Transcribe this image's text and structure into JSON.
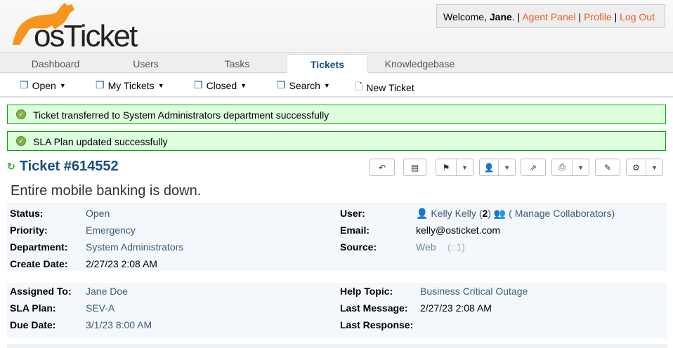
{
  "header": {
    "logo_text": "osTicket",
    "welcome_prefix": "Welcome, ",
    "user_name": "Jane",
    "links": [
      "Agent Panel",
      "Profile",
      "Log Out"
    ]
  },
  "nav": {
    "tabs": [
      {
        "label": "Dashboard"
      },
      {
        "label": "Users"
      },
      {
        "label": "Tasks"
      },
      {
        "label": "Tickets",
        "active": true
      },
      {
        "label": "Knowledgebase"
      }
    ]
  },
  "subnav": {
    "items": [
      {
        "label": "Open"
      },
      {
        "label": "My Tickets"
      },
      {
        "label": "Closed"
      },
      {
        "label": "Search"
      },
      {
        "label": "New Ticket"
      }
    ]
  },
  "alerts": [
    "Ticket transferred to System Administrators department successfully",
    "SLA Plan updated successfully"
  ],
  "ticket": {
    "title": "Ticket #614552",
    "subject": "Entire mobile banking is down."
  },
  "info1": {
    "status_label": "Status:",
    "status": "Open",
    "priority_label": "Priority:",
    "priority": "Emergency",
    "department_label": "Department:",
    "department": "System Administrators",
    "create_label": "Create Date:",
    "create_date": "2/27/23 2:08 AM",
    "user_label": "User:",
    "user": "Kelly Kelly",
    "user_count_open": "(",
    "user_count": "2",
    "user_count_close": ")",
    "collab": "( Manage Collaborators)",
    "email_label": "Email:",
    "email": "kelly@osticket.com",
    "source_label": "Source:",
    "source": "Web",
    "source_ip": "(::1)"
  },
  "info2": {
    "assigned_label": "Assigned To:",
    "assigned": "Jane Doe",
    "sla_label": "SLA Plan:",
    "sla": "SEV-A",
    "due_label": "Due Date:",
    "due": "3/1/23 8:00 AM",
    "topic_label": "Help Topic:",
    "topic": "Business Critical Outage",
    "lastmsg_label": "Last Message:",
    "lastmsg": "2/27/23 2:08 AM",
    "lastresp_label": "Last Response:"
  },
  "colors": {
    "brand": "#f7941d",
    "link": "#f15a24",
    "title": "#184e81",
    "alert_bg": "#ddffdd",
    "alert_border": "#00aa00"
  }
}
